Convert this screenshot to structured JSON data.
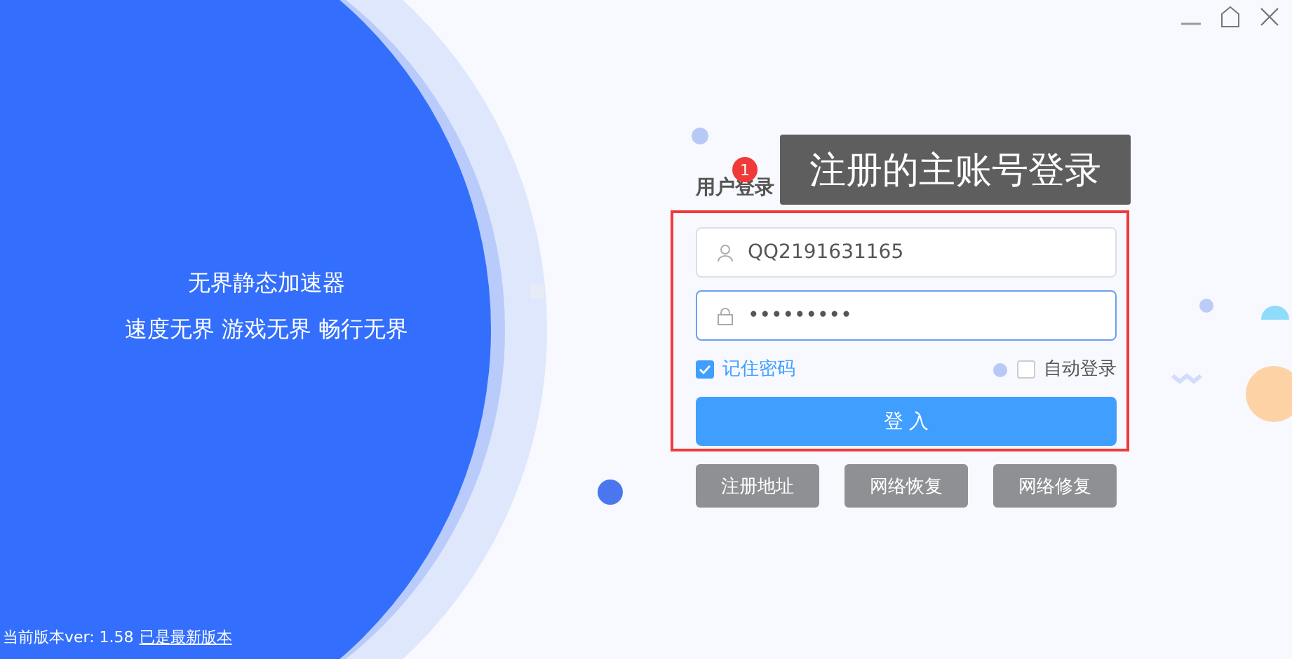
{
  "intro": {
    "title": "无界静态加速器",
    "slogan": "速度无界 游戏无界 畅行无界"
  },
  "login": {
    "title": "用户登录",
    "username": {
      "value": "QQ2191631165",
      "focused": false
    },
    "password": {
      "value": "•••••••••",
      "focused": true
    },
    "options": [
      {
        "label": "记住密码",
        "checked": true
      },
      {
        "label": "自动登录",
        "checked": false
      }
    ],
    "submit": "登 入"
  },
  "buttons": [
    "注册地址",
    "网络恢复",
    "网络修复"
  ],
  "annotation": {
    "number": "1",
    "label": "注册的主账号登录"
  },
  "footer": {
    "version": "当前版本ver: 1.58",
    "status_link": "已是最新版本"
  }
}
